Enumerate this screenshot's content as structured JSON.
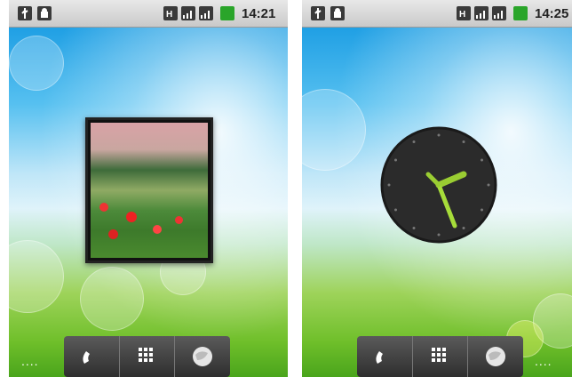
{
  "screens": [
    {
      "status": {
        "time": "14:21"
      },
      "widget": "photo-frame",
      "dock": {
        "items": [
          "phone",
          "apps",
          "browser"
        ],
        "extra": "...."
      }
    },
    {
      "status": {
        "time": "14:25"
      },
      "widget": "analog-clock",
      "dock": {
        "items": [
          "phone",
          "apps",
          "browser"
        ],
        "extra": "...."
      }
    }
  ]
}
